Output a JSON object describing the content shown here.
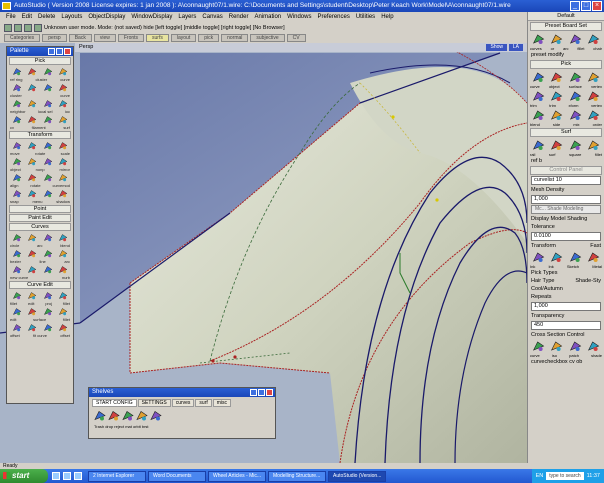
{
  "window": {
    "title": "AutoStudio ( Version 2008 License expires: 1 jan 2008 ): A\\connaught07/1.wire: C:\\Documents and Settings\\student\\Desktop\\Peter Keach Work\\Model\\A\\connaught07/1.wire",
    "minimize": "_",
    "maximize": "□",
    "close": "×"
  },
  "menu": [
    "File",
    "Edit",
    "Delete",
    "Layouts",
    "ObjectDisplay",
    "WindowDisplay",
    "Layers",
    "Canvas",
    "Render",
    "Animation",
    "Windows",
    "Preferences",
    "Utilities",
    "Help"
  ],
  "toolbar": {
    "mode_text": "Unknown user mode. Mode: (not saved) hide [left toggle] [middle toggle] [right toggle] [No Browser]"
  },
  "shelf_tabs": [
    {
      "label": "Categories",
      "active": false
    },
    {
      "label": "persp",
      "active": false
    },
    {
      "label": "Back",
      "active": false
    },
    {
      "label": "view",
      "active": false
    },
    {
      "label": "Fronts",
      "active": false
    },
    {
      "label": "surfs",
      "active": true
    },
    {
      "label": "layout",
      "active": false
    },
    {
      "label": "pick",
      "active": false
    },
    {
      "label": "normal",
      "active": false
    },
    {
      "label": "subjective",
      "active": false
    },
    {
      "label": "CV",
      "active": false
    }
  ],
  "viewport": {
    "label": "Persp",
    "right_tags": [
      "Show",
      "LA"
    ]
  },
  "palette": {
    "title": "Palette",
    "sections": [
      {
        "name": "Pick",
        "rows": [
          {
            "labels": [
              "ref ring",
              "cluster",
              "curve"
            ]
          },
          {
            "labels": [
              "cluster",
              "curve"
            ]
          },
          {
            "labels": [
              "neighbor",
              "local sel",
              "ioc"
            ]
          },
          {
            "labels": [
              "cv",
              "filament",
              "surf"
            ]
          }
        ]
      },
      {
        "name": "Transform",
        "rows": [
          {
            "labels": [
              "move",
              "rotate",
              "scale"
            ]
          },
          {
            "labels": [
              "object",
              "nonp",
              "mirror"
            ]
          },
          {
            "labels": [
              "align",
              "rotate",
              "curvemod"
            ]
          },
          {
            "labels": [
              "snap",
              "menu",
              "shadow"
            ]
          }
        ]
      },
      {
        "name": "Point",
        "rows": []
      },
      {
        "name": "Paint Edit",
        "rows": []
      },
      {
        "name": "Curves",
        "rows": [
          {
            "labels": [
              "circle",
              "arc",
              "blend"
            ]
          },
          {
            "labels": [
              "bezier",
              "line",
              "arc"
            ]
          },
          {
            "labels": [
              "new curve",
              "nurb"
            ]
          }
        ]
      },
      {
        "name": "Curve Edit",
        "rows": [
          {
            "labels": [
              "fillet",
              "edit",
              "proj",
              "fillet"
            ]
          },
          {
            "labels": [
              "edit",
              "surface",
              "fillet"
            ]
          },
          {
            "labels": [
              "offset",
              "fit curve",
              "offset"
            ]
          }
        ]
      }
    ]
  },
  "right_panel": {
    "default_title": "Default",
    "preset_title": "Preset Board Set",
    "top_labels": [
      "curves",
      "or",
      "arc",
      "fillet",
      "chair"
    ],
    "preset_label": "preset modify",
    "pick_section": "Pick",
    "pick_rows": [
      {
        "labels": [
          "curve",
          "object",
          "surface",
          "vertex"
        ]
      },
      {
        "labels": [
          "trim",
          "trim",
          "xform",
          "vertex"
        ]
      },
      {
        "labels": [
          "blend",
          "side",
          "mix",
          "order"
        ]
      }
    ],
    "surf_section": "Surf",
    "surf_labels": [
      "rail",
      "surf",
      "square",
      "fillet"
    ],
    "surf_extra": "ref b",
    "control_panel": "Control Panel",
    "curve_label": "curvelist 10",
    "mesh_density_label": "Mesh Density",
    "mesh_density_value": "1,000",
    "model_display_btn": "Mc... Shade Modeling",
    "display_toggle": "Display Model Shading",
    "tolerance_label": "Tolerance",
    "tolerance_value": "0.0100",
    "transform_label": "Transform",
    "transform_right": "Fast",
    "transform_types": [
      "Ink",
      "Ink",
      "Sketch",
      "Metal"
    ],
    "pick_types_label": "Pick Types",
    "hair_type_label": "Hair Type",
    "shade_label": "Shade-Sty",
    "model_name": "Cool/Autumn",
    "repeats_label": "Repeats",
    "repeats_value": "1,000",
    "transparency_label": "Transparency",
    "transparency_value": "450",
    "cross_section_toggle": "Cross Section Control",
    "bottom_labels": [
      "curve",
      "iso",
      "patch",
      "shade"
    ],
    "bottom_extra": "curvecheckbox cv ob"
  },
  "shelves": {
    "title": "Shelves",
    "tabs": [
      {
        "label": "START CONFIG",
        "active": true
      },
      {
        "label": "SETTINGS",
        "active": false
      },
      {
        "label": "curves",
        "active": false
      },
      {
        "label": "surf",
        "active": false
      },
      {
        "label": "misc",
        "active": false
      }
    ],
    "caption": "Trash drop reject mat orbit brst",
    "icons": [
      "trash-icon",
      "paint-icon",
      "graph-icon",
      "chart-icon",
      "grid-icon"
    ]
  },
  "status": "Ready",
  "taskbar": {
    "start": "start",
    "tasks": [
      {
        "label": "2 Internet Explorer",
        "active": false
      },
      {
        "label": "Word Documents",
        "active": false
      },
      {
        "label": "Wheel Articles - Mic...",
        "active": false
      },
      {
        "label": "Modelling Structure...",
        "active": false
      },
      {
        "label": "AutoStudio (Version...",
        "active": true
      }
    ],
    "lang": "EN",
    "search_text": "type to search",
    "clock": "11:37"
  },
  "colors": {
    "title_blue": "#2a5fd3",
    "surface_gray": "#d6dac8",
    "dark_blue_surface": "#8390b8",
    "curve_red": "#a22",
    "curve_dark": "#1a1a6a"
  }
}
